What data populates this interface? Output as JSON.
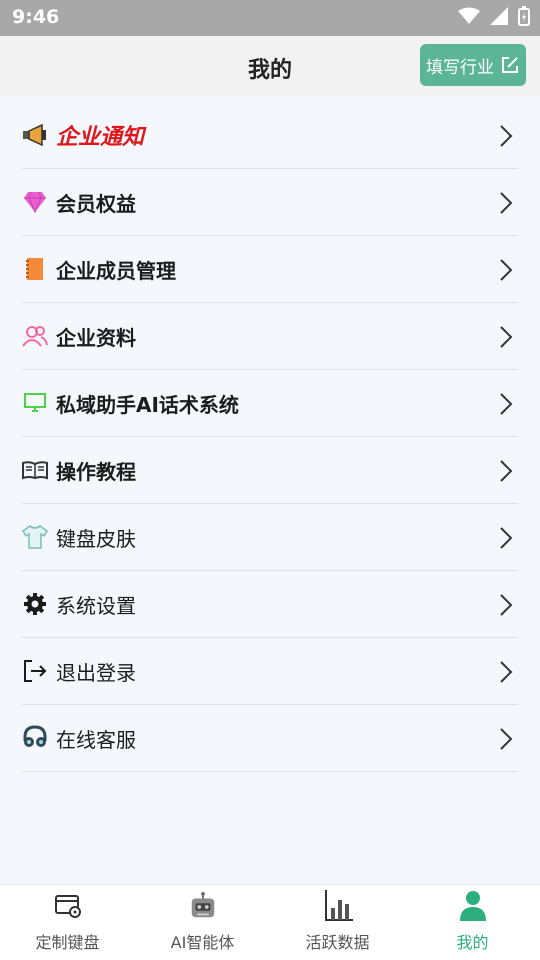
{
  "status_bar": {
    "time": "9:46"
  },
  "header": {
    "title": "我的",
    "fill_button": "填写行业"
  },
  "menu": [
    {
      "label": "企业通知",
      "icon": "megaphone-icon",
      "style": "alert"
    },
    {
      "label": "会员权益",
      "icon": "diamond-icon",
      "style": "bold"
    },
    {
      "label": "企业成员管理",
      "icon": "notebook-icon",
      "style": "bold"
    },
    {
      "label": "企业资料",
      "icon": "people-icon",
      "style": "bold"
    },
    {
      "label": "私域助手AI话术系统",
      "icon": "monitor-icon",
      "style": "bold"
    },
    {
      "label": "操作教程",
      "icon": "open-book-icon",
      "style": "bold"
    },
    {
      "label": "键盘皮肤",
      "icon": "tshirt-icon",
      "style": "normal"
    },
    {
      "label": "系统设置",
      "icon": "gear-icon",
      "style": "normal"
    },
    {
      "label": "退出登录",
      "icon": "logout-icon",
      "style": "normal"
    },
    {
      "label": "在线客服",
      "icon": "headset-icon",
      "style": "normal"
    }
  ],
  "tabs": [
    {
      "label": "定制键盘",
      "icon": "keyboard-card-icon",
      "active": false
    },
    {
      "label": "AI智能体",
      "icon": "robot-icon",
      "active": false
    },
    {
      "label": "活跃数据",
      "icon": "bar-chart-icon",
      "active": false
    },
    {
      "label": "我的",
      "icon": "profile-icon",
      "active": true
    }
  ],
  "colors": {
    "accent": "#5db597",
    "alert": "#e0161b",
    "active_tab": "#2cae7e"
  }
}
